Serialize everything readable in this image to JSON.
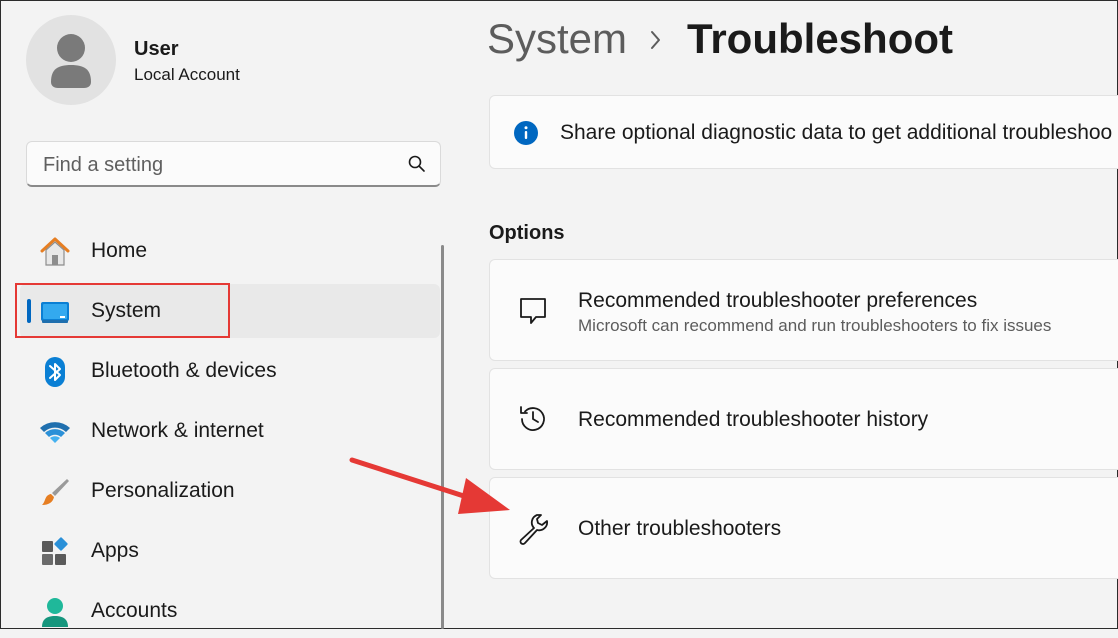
{
  "user": {
    "name": "User",
    "account_type": "Local Account"
  },
  "search": {
    "placeholder": "Find a setting",
    "value": ""
  },
  "nav": {
    "items": [
      {
        "label": "Home",
        "icon": "home-icon"
      },
      {
        "label": "System",
        "icon": "system-monitor-icon",
        "selected": true
      },
      {
        "label": "Bluetooth & devices",
        "icon": "bluetooth-icon"
      },
      {
        "label": "Network & internet",
        "icon": "wifi-icon"
      },
      {
        "label": "Personalization",
        "icon": "paintbrush-icon"
      },
      {
        "label": "Apps",
        "icon": "apps-icon"
      },
      {
        "label": "Accounts",
        "icon": "person-icon"
      }
    ]
  },
  "header": {
    "parent": "System",
    "current": "Troubleshoot",
    "separator_icon": "chevron-right-icon"
  },
  "info_banner": {
    "text": "Share optional diagnostic data to get additional troubleshoo",
    "icon": "info-icon"
  },
  "options": {
    "title": "Options",
    "items": [
      {
        "title": "Recommended troubleshooter preferences",
        "subtitle": "Microsoft can recommend and run troubleshooters to fix issues",
        "icon": "speech-bubble-icon"
      },
      {
        "title": "Recommended troubleshooter history",
        "icon": "history-icon"
      },
      {
        "title": "Other troubleshooters",
        "icon": "wrench-icon"
      }
    ]
  },
  "colors": {
    "accent": "#0067c0",
    "annotation": "#e53935",
    "background": "#f3f3f3",
    "card": "#fbfbfb"
  }
}
